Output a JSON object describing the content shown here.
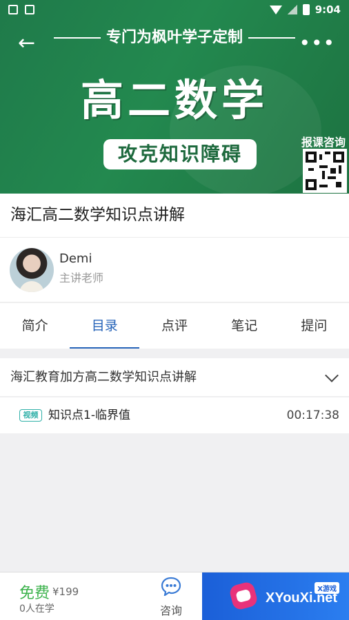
{
  "status_bar": {
    "time": "9:04"
  },
  "banner": {
    "slogan": "专门为枫叶学子定制",
    "title": "高二数学",
    "pill_text": "攻克知识障碍",
    "qr_label": "报课咨询"
  },
  "course": {
    "title": "海汇高二数学知识点讲解"
  },
  "teacher": {
    "name": "Demi",
    "role": "主讲老师"
  },
  "tabs": [
    {
      "label": "简介"
    },
    {
      "label": "目录"
    },
    {
      "label": "点评"
    },
    {
      "label": "笔记"
    },
    {
      "label": "提问"
    }
  ],
  "active_tab": "目录",
  "catalog": {
    "chapter_title": "海汇教育加方高二数学知识点讲解",
    "lessons": [
      {
        "tag": "视频",
        "title": "知识点1-临界值",
        "duration": "00:17:38"
      }
    ]
  },
  "bottom_bar": {
    "price": "免费",
    "original_price": "¥199",
    "learners": "0人在学",
    "consult_label": "咨询"
  },
  "ad": {
    "brand": "XYouXi.net",
    "tag": "X游戏"
  },
  "colors": {
    "accent": "#2563b8",
    "price": "#3bb24b",
    "banner": "#23894f",
    "tag": "#2fb0a8"
  }
}
